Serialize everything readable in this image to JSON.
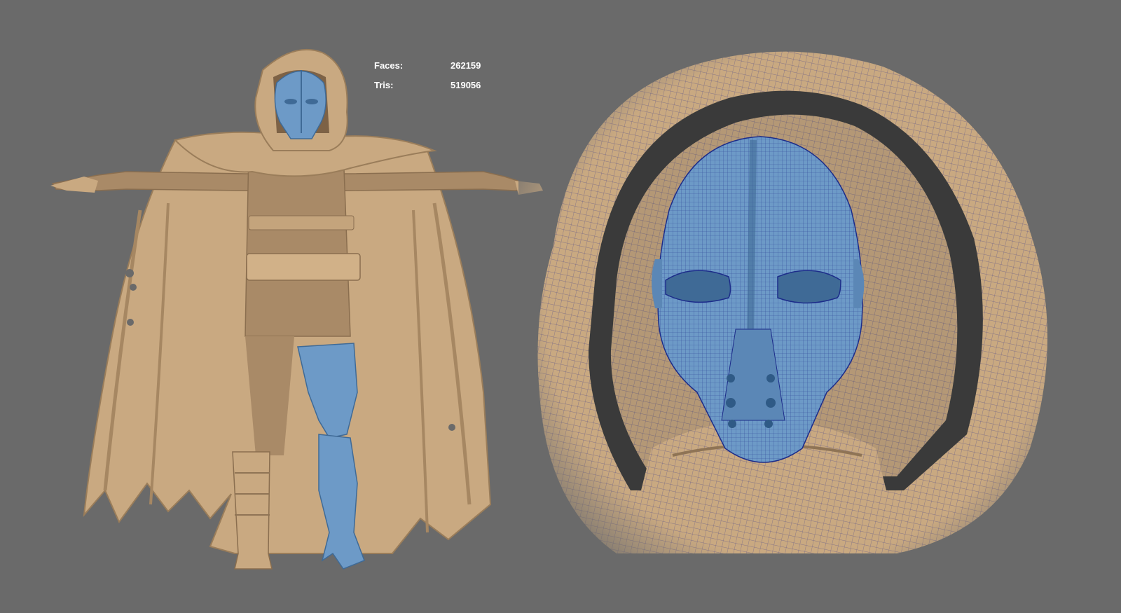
{
  "hud": {
    "faces_label": "Faces:",
    "faces_value": "262159",
    "tris_label": "Tris:",
    "tris_value": "519056"
  },
  "colors": {
    "background": "#6a6a6a",
    "cloth": "#c9a981",
    "cloth_shadow": "#8f7455",
    "mask": "#6d9ac7",
    "mask_shadow": "#3f6a96",
    "wireframe": "#1c1f88"
  }
}
